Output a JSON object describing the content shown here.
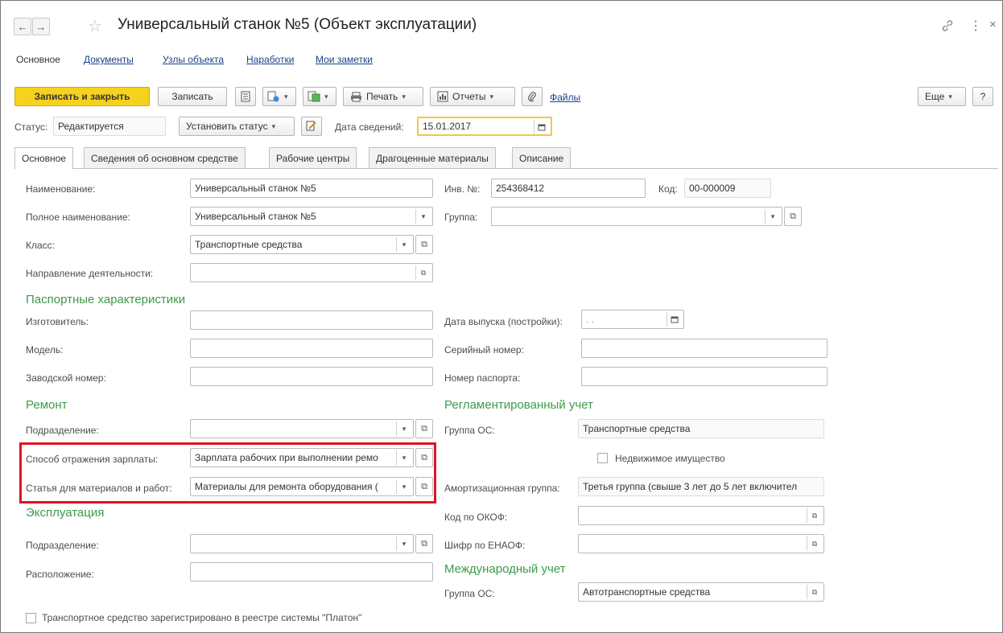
{
  "window": {
    "title": "Универсальный станок №5 (Объект эксплуатации)",
    "back_icon": "←",
    "forward_icon": "→",
    "star_icon": "☆",
    "link_icon": "🔗",
    "more_icon": "⋮",
    "close_icon": "×"
  },
  "sections": {
    "main": "Основное",
    "documents": "Документы",
    "nodes": "Узлы объекта",
    "operating_time": "Наработки",
    "notes": "Мои заметки"
  },
  "toolbar": {
    "save_close": "Записать и закрыть",
    "save": "Записать",
    "print": "Печать",
    "reports": "Отчеты",
    "files": "Файлы",
    "more": "Еще",
    "help": "?"
  },
  "status": {
    "label": "Статус:",
    "value": "Редактируется",
    "set_status": "Установить статус",
    "date_label": "Дата сведений:",
    "date_value": "15.01.2017"
  },
  "tabs": [
    {
      "label": "Основное"
    },
    {
      "label": "Сведения об основном средстве"
    },
    {
      "label": "Рабочие центры"
    },
    {
      "label": "Драгоценные материалы"
    },
    {
      "label": "Описание"
    }
  ],
  "form": {
    "name_label": "Наименование:",
    "name_value": "Универсальный станок №5",
    "full_name_label": "Полное наименование:",
    "full_name_value": "Универсальный станок №5",
    "class_label": "Класс:",
    "class_value": "Транспортные средства",
    "activity_label": "Направление деятельности:",
    "activity_value": "",
    "inv_label": "Инв. №:",
    "inv_value": "254368412",
    "code_label": "Код:",
    "code_value": "00-000009",
    "group_label": "Группа:",
    "group_value": ""
  },
  "passport": {
    "title": "Паспортные характеристики",
    "manufacturer_label": "Изготовитель:",
    "model_label": "Модель:",
    "serial_factory_label": "Заводской номер:",
    "release_date_label": "Дата выпуска (постройки):",
    "release_date_value": " .  .",
    "serial_label": "Серийный номер:",
    "passport_no_label": "Номер паспорта:"
  },
  "repair": {
    "title": "Ремонт",
    "division_label": "Подразделение:",
    "salary_label": "Способ отражения зарплаты:",
    "salary_value": "Зарплата рабочих при выполнении ремо",
    "materials_label": "Статья для материалов и работ:",
    "materials_value": "Материалы для ремонта оборудования ("
  },
  "regulated": {
    "title": "Регламентированный учет",
    "os_group_label": "Группа ОС:",
    "os_group_value": "Транспортные средства",
    "real_estate_label": "Недвижимое имущество",
    "amort_label": "Амортизационная группа:",
    "amort_value": "Третья группа (свыше 3 лет до 5 лет включител",
    "okof_label": "Код по ОКОФ:",
    "enaof_label": "Шифр по ЕНАОФ:"
  },
  "exploitation": {
    "title": "Эксплуатация",
    "division_label": "Подразделение:",
    "location_label": "Расположение:"
  },
  "international": {
    "title": "Международный учет",
    "os_group_label": "Группа ОС:",
    "os_group_value": "Автотранспортные средства"
  },
  "platon": {
    "label": "Транспортное средство зарегистрировано в реестре системы \"Платон\""
  }
}
